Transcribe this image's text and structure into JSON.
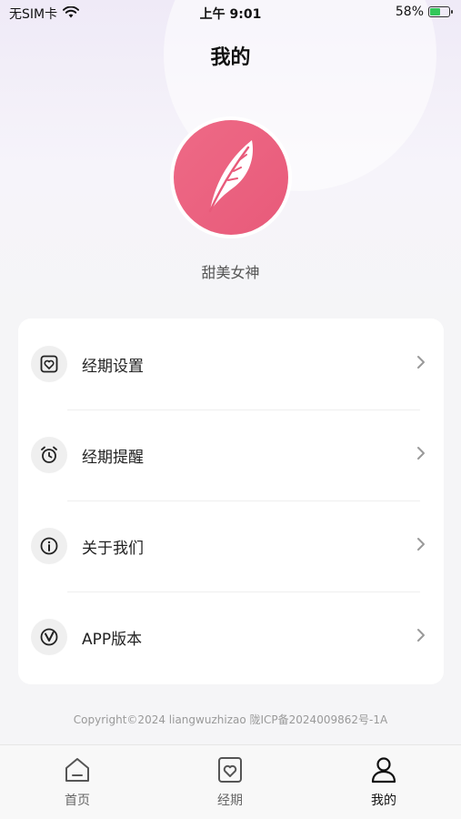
{
  "status_bar": {
    "carrier": "无SIM卡",
    "time": "上午 9:01",
    "battery": "58%",
    "battery_level": 0.58
  },
  "header": {
    "title": "我的"
  },
  "profile": {
    "nickname": "甜美女神",
    "avatar_icon": "feather-icon"
  },
  "menu": {
    "items": [
      {
        "label": "经期设置",
        "icon": "heart-calendar-icon"
      },
      {
        "label": "经期提醒",
        "icon": "alarm-clock-icon"
      },
      {
        "label": "关于我们",
        "icon": "info-icon"
      },
      {
        "label": "APP版本",
        "icon": "version-v-icon"
      }
    ]
  },
  "footer": {
    "copyright": "Copyright©2024 liangwuzhizao 陇ICP备2024009862号-1A"
  },
  "tab_bar": {
    "tabs": [
      {
        "label": "首页",
        "icon": "home-icon",
        "active": false
      },
      {
        "label": "经期",
        "icon": "heart-calendar-icon",
        "active": false
      },
      {
        "label": "我的",
        "icon": "person-icon",
        "active": true
      }
    ]
  },
  "colors": {
    "avatar": "#e85a7a",
    "background": "#f5f5f7",
    "battery": "#33c759"
  }
}
